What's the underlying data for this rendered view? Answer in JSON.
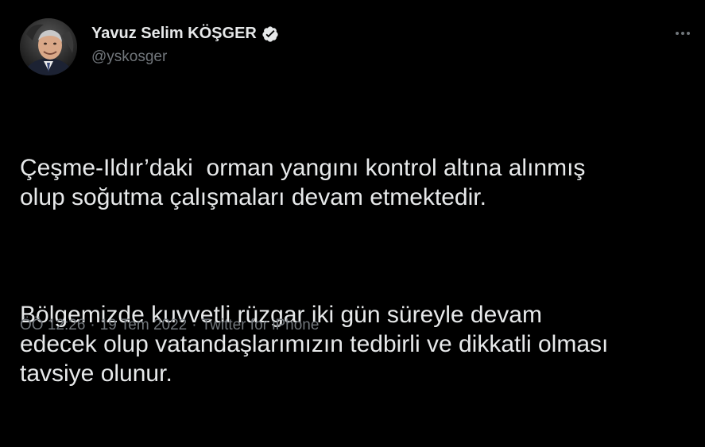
{
  "author": {
    "display_name": "Yavuz Selim KÖŞGER",
    "handle": "@yskosger",
    "verified": true,
    "verified_color": "#e7e9ea"
  },
  "tweet": {
    "paragraphs": [
      "Çeşme-Ildır’daki  orman yangını kontrol altına alınmış\nolup soğutma çalışmaları devam etmektedir.",
      "Bölgemizde kuvvetli rüzgar iki gün süreyle devam\nedecek olup vatandaşlarımızın tedbirli ve dikkatli olması\ntavsiye olunur."
    ]
  },
  "meta": {
    "time": "ÖÖ 12:26",
    "separator1": "·",
    "date": "19 Tem 2022",
    "separator2": "·",
    "source": "Twitter for iPhone"
  },
  "icons": {
    "more": "more-horizontal-icon",
    "verified": "verified-badge-icon"
  },
  "colors": {
    "background": "#000000",
    "primary_text": "#e7e9ea",
    "secondary_text": "#71767b"
  }
}
